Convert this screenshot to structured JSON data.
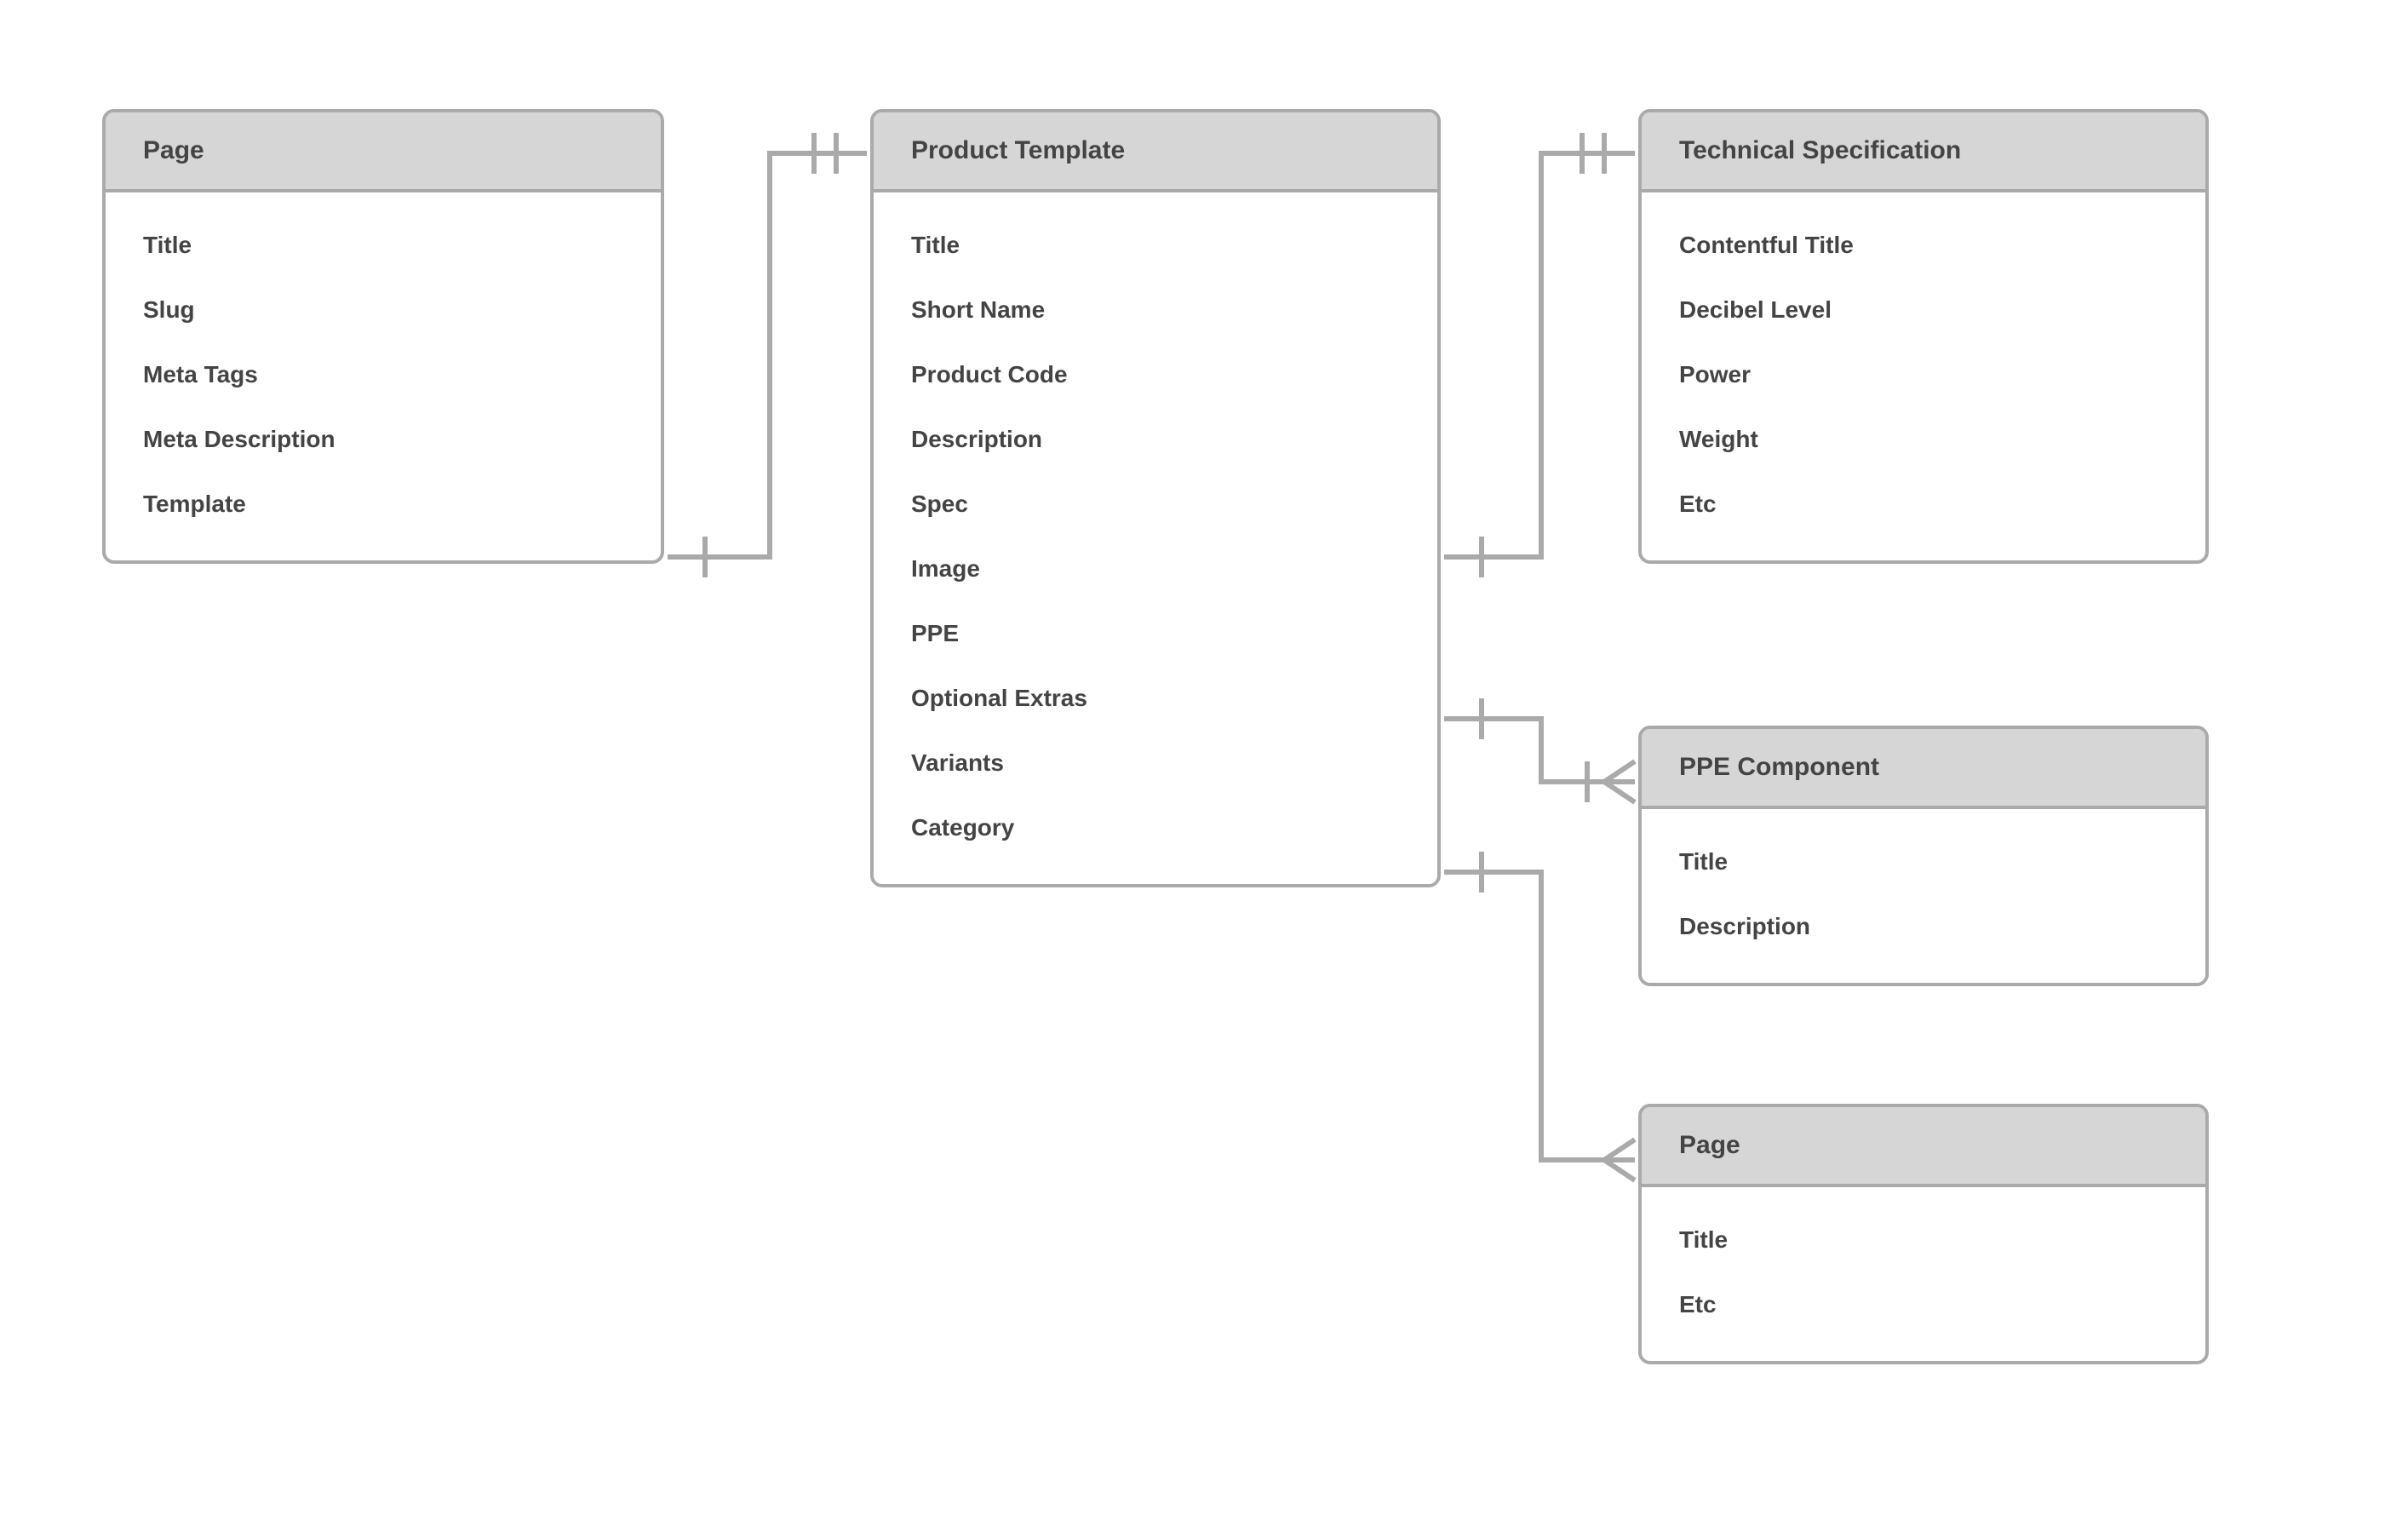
{
  "entities": {
    "page1": {
      "title": "Page",
      "attrs": [
        "Title",
        "Slug",
        "Meta Tags",
        "Meta Description",
        "Template"
      ]
    },
    "product": {
      "title": "Product Template",
      "attrs": [
        "Title",
        "Short Name",
        "Product Code",
        "Description",
        "Spec",
        "Image",
        "PPE",
        "Optional Extras",
        "Variants",
        "Category"
      ]
    },
    "techspec": {
      "title": "Technical Specification",
      "attrs": [
        "Contentful Title",
        "Decibel Level",
        "Power",
        "Weight",
        "Etc"
      ]
    },
    "ppe": {
      "title": "PPE Component",
      "attrs": [
        "Title",
        "Description"
      ]
    },
    "page2": {
      "title": "Page",
      "attrs": [
        "Title",
        "Etc"
      ]
    }
  },
  "relationships": [
    {
      "from": "page1",
      "to": "product",
      "from_card": "one",
      "to_card": "one-strict"
    },
    {
      "from": "product",
      "to": "techspec",
      "from_card": "one",
      "to_card": "one-strict"
    },
    {
      "from": "product",
      "to": "ppe",
      "from_card": "one",
      "to_card": "many"
    },
    {
      "from": "product",
      "to": "page2",
      "from_card": "one",
      "to_card": "many"
    }
  ]
}
